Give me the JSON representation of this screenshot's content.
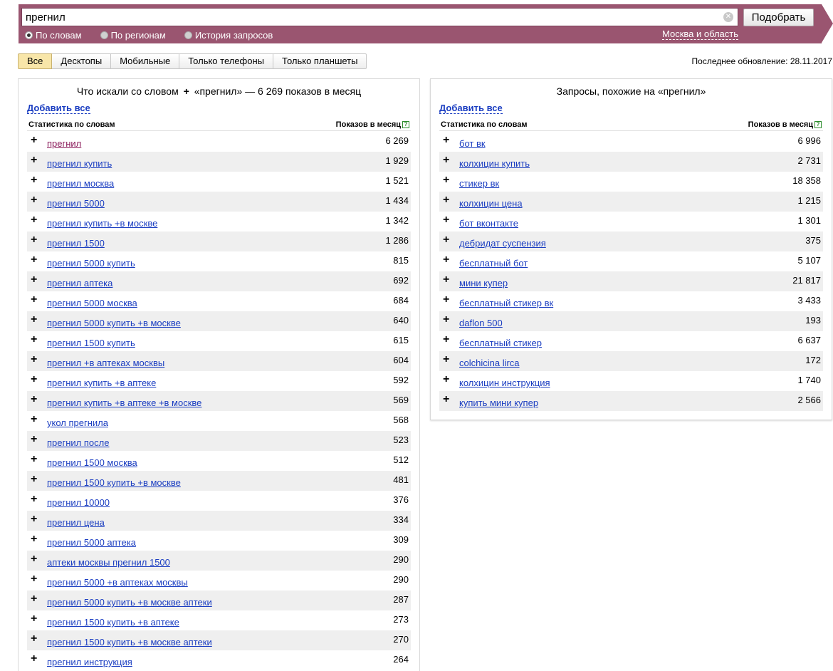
{
  "search": {
    "query": "прегнил",
    "button_label": "Подобрать",
    "modes": [
      {
        "label": "По словам",
        "checked": true
      },
      {
        "label": "По регионам",
        "checked": false
      },
      {
        "label": "История запросов",
        "checked": false
      }
    ],
    "region": "Москва и область"
  },
  "tabs": [
    {
      "label": "Все",
      "active": true
    },
    {
      "label": "Десктопы",
      "active": false
    },
    {
      "label": "Мобильные",
      "active": false
    },
    {
      "label": "Только телефоны",
      "active": false
    },
    {
      "label": "Только планшеты",
      "active": false
    }
  ],
  "last_update": "Последнее обновление: 28.11.2017",
  "left_panel": {
    "title_before": "Что искали со словом",
    "title_plus": "+",
    "title_after": "«прегнил» — 6 269 показов в месяц",
    "add_all": "Добавить все",
    "col_words": "Статистика по словам",
    "col_shows": "Показов в месяц",
    "help": "?",
    "rows": [
      {
        "phrase": "прегнил",
        "count": "6 269"
      },
      {
        "phrase": "прегнил купить",
        "count": "1 929"
      },
      {
        "phrase": "прегнил москва",
        "count": "1 521"
      },
      {
        "phrase": "прегнил 5000",
        "count": "1 434"
      },
      {
        "phrase": "прегнил купить +в москве",
        "count": "1 342"
      },
      {
        "phrase": "прегнил 1500",
        "count": "1 286"
      },
      {
        "phrase": "прегнил 5000 купить",
        "count": "815"
      },
      {
        "phrase": "прегнил аптека",
        "count": "692"
      },
      {
        "phrase": "прегнил 5000 москва",
        "count": "684"
      },
      {
        "phrase": "прегнил 5000 купить +в москве",
        "count": "640"
      },
      {
        "phrase": "прегнил 1500 купить",
        "count": "615"
      },
      {
        "phrase": "прегнил +в аптеках москвы",
        "count": "604"
      },
      {
        "phrase": "прегнил купить +в аптеке",
        "count": "592"
      },
      {
        "phrase": "прегнил купить +в аптеке +в москве",
        "count": "569"
      },
      {
        "phrase": "укол прегнила",
        "count": "568"
      },
      {
        "phrase": "прегнил после",
        "count": "523"
      },
      {
        "phrase": "прегнил 1500 москва",
        "count": "512"
      },
      {
        "phrase": "прегнил 1500 купить +в москве",
        "count": "481"
      },
      {
        "phrase": "прегнил 10000",
        "count": "376"
      },
      {
        "phrase": "прегнил цена",
        "count": "334"
      },
      {
        "phrase": "прегнил 5000 аптека",
        "count": "309"
      },
      {
        "phrase": "аптеки москвы прегнил 1500",
        "count": "290"
      },
      {
        "phrase": "прегнил 5000 +в аптеках москвы",
        "count": "290"
      },
      {
        "phrase": "прегнил 5000 купить +в москве аптеки",
        "count": "287"
      },
      {
        "phrase": "прегнил 1500 купить +в аптеке",
        "count": "273"
      },
      {
        "phrase": "прегнил 1500 купить +в москве аптеки",
        "count": "270"
      },
      {
        "phrase": "прегнил инструкция",
        "count": "264"
      }
    ]
  },
  "right_panel": {
    "title": "Запросы, похожие на «прегнил»",
    "add_all": "Добавить все",
    "col_words": "Статистика по словам",
    "col_shows": "Показов в месяц",
    "help": "?",
    "rows": [
      {
        "phrase": "бот вк",
        "count": "6 996"
      },
      {
        "phrase": "колхицин купить",
        "count": "2 731"
      },
      {
        "phrase": "стикер вк",
        "count": "18 358"
      },
      {
        "phrase": "колхицин цена",
        "count": "1 215"
      },
      {
        "phrase": "бот вконтакте",
        "count": "1 301"
      },
      {
        "phrase": "дебридат суспензия",
        "count": "375"
      },
      {
        "phrase": "бесплатный бот",
        "count": "5 107"
      },
      {
        "phrase": "мини купер",
        "count": "21 817"
      },
      {
        "phrase": "бесплатный стикер вк",
        "count": "3 433"
      },
      {
        "phrase": "daflon 500",
        "count": "193"
      },
      {
        "phrase": "бесплатный стикер",
        "count": "6 637"
      },
      {
        "phrase": "colchicina lirca",
        "count": "172"
      },
      {
        "phrase": "колхицин инструкция",
        "count": "1 740"
      },
      {
        "phrase": "купить мини купер",
        "count": "2 566"
      }
    ]
  }
}
